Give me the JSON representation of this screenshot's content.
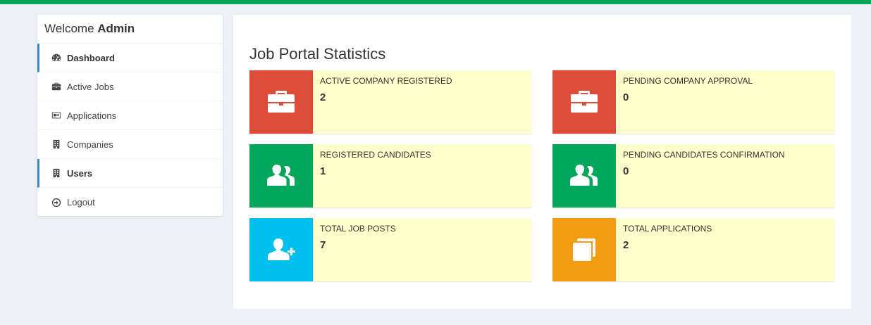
{
  "colors": {
    "topbar": "#00a65a",
    "red": "#dd4b39",
    "green": "#00a65a",
    "aqua": "#00c0ef",
    "orange": "#f39c12",
    "box_bg": "#ffffcc",
    "active_border": "#3c8dbc"
  },
  "sidebar": {
    "welcome_prefix": "Welcome",
    "welcome_user": "Admin",
    "items": [
      {
        "label": "Dashboard",
        "icon": "dashboard-icon",
        "active": true
      },
      {
        "label": "Active Jobs",
        "icon": "briefcase-icon",
        "active": false
      },
      {
        "label": "Applications",
        "icon": "id-card-icon",
        "active": false
      },
      {
        "label": "Companies",
        "icon": "building-icon",
        "active": false
      },
      {
        "label": "Users",
        "icon": "building-icon",
        "active": true
      },
      {
        "label": "Logout",
        "icon": "sign-out-icon",
        "active": false
      }
    ]
  },
  "main": {
    "title": "Job Portal Statistics",
    "stats": [
      {
        "label": "ACTIVE COMPANY REGISTERED",
        "value": "2",
        "icon": "briefcase-icon",
        "color": "red"
      },
      {
        "label": "PENDING COMPANY APPROVAL",
        "value": "0",
        "icon": "briefcase-icon",
        "color": "red"
      },
      {
        "label": "REGISTERED CANDIDATES",
        "value": "1",
        "icon": "users-icon",
        "color": "green"
      },
      {
        "label": "PENDING CANDIDATES CONFIRMATION",
        "value": "0",
        "icon": "users-icon",
        "color": "green"
      },
      {
        "label": "TOTAL JOB POSTS",
        "value": "7",
        "icon": "user-plus-icon",
        "color": "aqua"
      },
      {
        "label": "TOTAL APPLICATIONS",
        "value": "2",
        "icon": "copy-icon",
        "color": "orange"
      }
    ]
  }
}
